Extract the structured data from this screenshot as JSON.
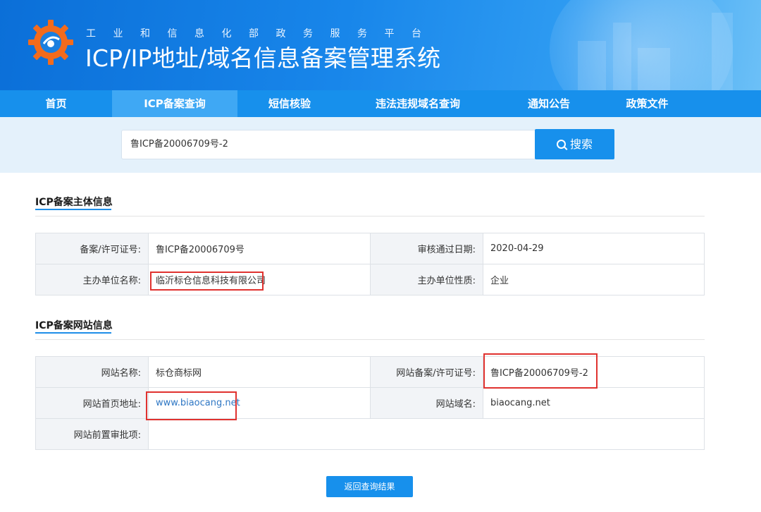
{
  "header": {
    "subtitle": "工业和信息化部政务服务平台",
    "title": "ICP/IP地址/域名信息备案管理系统"
  },
  "nav": {
    "items": [
      {
        "label": "首页"
      },
      {
        "label": "ICP备案查询",
        "active": true
      },
      {
        "label": "短信核验"
      },
      {
        "label": "违法违规域名查询"
      },
      {
        "label": "通知公告"
      },
      {
        "label": "政策文件"
      }
    ]
  },
  "search": {
    "value": "鲁ICP备20006709号-2",
    "button_label": "搜索"
  },
  "subject_section": {
    "title": "ICP备案主体信息",
    "rows": [
      {
        "label1": "备案/许可证号:",
        "value1": "鲁ICP备20006709号",
        "label2": "审核通过日期:",
        "value2": "2020-04-29"
      },
      {
        "label1": "主办单位名称:",
        "value1": "临沂标仓信息科技有限公司",
        "label2": "主办单位性质:",
        "value2": "企业"
      }
    ]
  },
  "website_section": {
    "title": "ICP备案网站信息",
    "row1": {
      "label1": "网站名称:",
      "value1": "标仓商标网",
      "label2": "网站备案/许可证号:",
      "value2": "鲁ICP备20006709号-2"
    },
    "row2": {
      "label1": "网站首页地址:",
      "value1": "www.biaocang.net",
      "label2": "网站域名:",
      "value2": "biaocang.net"
    },
    "row3": {
      "label1": "网站前置审批项:",
      "value1": ""
    }
  },
  "footer": {
    "back_label": "返回查询结果"
  },
  "colors": {
    "primary": "#1790ec",
    "nav_active": "#3fa8f4",
    "highlight": "#e0322f"
  }
}
